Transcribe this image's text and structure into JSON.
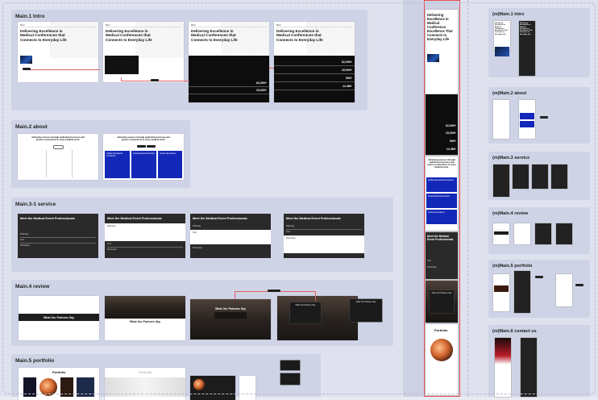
{
  "sections": {
    "main_1": {
      "title": "Main.1 Intro"
    },
    "main_2": {
      "title": "Main.2 about"
    },
    "main_3": {
      "title": "Main.3-1 service"
    },
    "main_4": {
      "title": "Main.4 review"
    },
    "main_5": {
      "title": "Main.5 portfolio"
    }
  },
  "intro": {
    "logo": "MCV",
    "hero_text": "Delivering Excellence in Medical Conferences that Connects to Everyday Life",
    "stats": [
      "62,000+",
      "15,000+",
      "900+",
      "14.4M+"
    ]
  },
  "about": {
    "tagline": "Achieving success through optimized processes and precise connections in every medical event.",
    "blue_cards": [
      "Global Operational Excellence",
      "Outstanding Partnerships",
      "Content Excellence"
    ]
  },
  "service": {
    "title": "Meet the Medical Event Professionals",
    "items": [
      "Planning",
      "Tool",
      "Promotion"
    ]
  },
  "review": {
    "text": "What Our Partners Say"
  },
  "portfolio": {
    "title": "Portfolio"
  },
  "mobile": {
    "hero_text": "Delivering Excellence in Medical Conference Excellence That Connects to Everyday Life",
    "service_title": "Meet the Medical Event Professionals",
    "portfolio_title": "Portfolio"
  },
  "right_sections": {
    "m1": "(m)Main.1 Intro",
    "m2": "(m)Main.2 about",
    "m3": "(m)Main.3 service",
    "m4": "(m)Main.4 review",
    "m5": "(m)Main.5 portfolio",
    "m6": "(m)Main.6 contact us"
  }
}
